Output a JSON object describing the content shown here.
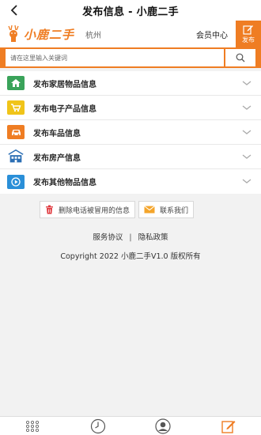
{
  "topnav": {
    "title": "发布信息 - 小鹿二手",
    "back_icon": "chevron-left-icon"
  },
  "header": {
    "logo_text": "小鹿二手",
    "city": "杭州",
    "member_center": "会员中心",
    "publish_label": "发布"
  },
  "search": {
    "placeholder": "请在这里输入关键词",
    "value": ""
  },
  "categories": [
    {
      "label": "发布家居物品信息",
      "icon": "house-icon",
      "color": "#3aa35a"
    },
    {
      "label": "发布电子产品信息",
      "icon": "cart-icon",
      "color": "#f0c419"
    },
    {
      "label": "发布车品信息",
      "icon": "car-icon",
      "color": "#ef7d23"
    },
    {
      "label": "发布房产信息",
      "icon": "building-icon",
      "color": "#2c6fb4"
    },
    {
      "label": "发布其他物品信息",
      "icon": "play-icon",
      "color": "#2a8fd8"
    }
  ],
  "actions": {
    "delete_label": "删除电话被冒用的信息",
    "contact_label": "联系我们"
  },
  "footer": {
    "terms": "服务协议",
    "separator": "|",
    "privacy": "隐私政策",
    "copyright": "Copyright 2022 小鹿二手V1.0 版权所有"
  },
  "colors": {
    "accent": "#ef7d23"
  }
}
